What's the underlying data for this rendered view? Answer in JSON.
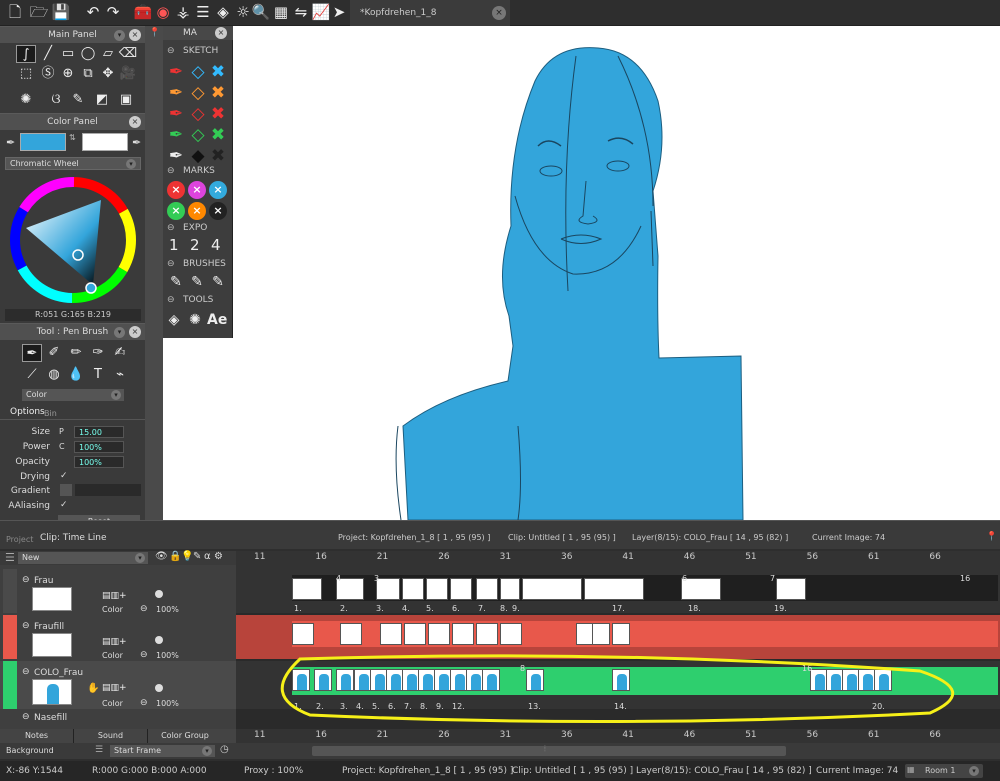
{
  "doc_tab": {
    "title": "*Kopfdrehen_1_8"
  },
  "main_panel": {
    "title": "Main Panel"
  },
  "color_panel": {
    "title": "Color Panel",
    "mode": "Chromatic Wheel",
    "readout": "R:051 G:165 B:219",
    "fg_color": "#33a5db",
    "bg_color": "#ffffff"
  },
  "tool_panel": {
    "title": "Tool : Pen Brush",
    "color_dropdown": "Color",
    "tabs": [
      "Options",
      "Bin"
    ],
    "size_label": "Size",
    "size_mode": "P",
    "size_value": "15.00",
    "power_label": "Power",
    "power_mode": "C",
    "power_value": "100%",
    "opacity_label": "Opacity",
    "opacity_value": "100%",
    "drying_label": "Drying",
    "gradient_label": "Gradient",
    "aaliasing_label": "AAliasing",
    "reset": "Reset"
  },
  "ma_panel": {
    "title": "MA",
    "sketch": "SKETCH",
    "marks": "MARKS",
    "expo": "EXPO",
    "brushes": "BRUSHES",
    "tools": "TOOLS",
    "expo_values": [
      "1",
      "2",
      "4"
    ],
    "ae": "Ae"
  },
  "timeline": {
    "tabs": [
      "Project",
      "Clip: Time Line"
    ],
    "project_info": "Project: Kopfdrehen_1_8 [ 1 , 95  (95) ]",
    "clip_info": "Clip: Untitled [ 1 , 95  (95) ]",
    "layer_info": "Layer(8/15): COLO_Frau [ 14 , 95  (82) ]",
    "current_image": "Current Image: 74",
    "new_label": "New",
    "ruler": [
      "11",
      "16",
      "21",
      "26",
      "31",
      "36",
      "41",
      "46",
      "51",
      "56",
      "61",
      "66"
    ],
    "layers": [
      {
        "name": "Frau",
        "color_label": "Color",
        "opacity": "100%"
      },
      {
        "name": "Fraufill",
        "color_label": "Color",
        "opacity": "100%"
      },
      {
        "name": "COLO_Frau",
        "color_label": "Color",
        "opacity": "100%"
      },
      {
        "name": "Nasefill"
      }
    ],
    "frau_numbers": [
      "1.",
      "2.",
      "3.",
      "4.",
      "5.",
      "6.",
      "7.",
      "8.",
      "9.",
      "17.",
      "18.",
      "19."
    ],
    "frau_box_labels": [
      "4",
      "3",
      "6",
      "7",
      "16"
    ],
    "colo_numbers": [
      "1.",
      "2.",
      "3.",
      "4.",
      "5.",
      "6.",
      "7.",
      "8.",
      "9.",
      "12.",
      "13.",
      "14.",
      "20."
    ],
    "colo_box_labels": [
      "8",
      "16"
    ],
    "bottom_tabs": [
      "Notes",
      "Sound",
      "Color Group"
    ],
    "background_label": "Background",
    "start_frame": "Start Frame",
    "frame_accent": "#2ecf6e",
    "fill_accent": "#e8584b"
  },
  "status": {
    "cursor": "X:-86  Y:1544",
    "rgba": "R:000 G:000 B:000 A:000",
    "proxy": "Proxy : 100%",
    "project": "Project: Kopfdrehen_1_8 [ 1 , 95  (95) ]",
    "clip": "Clip: Untitled [ 1 , 95  (95) ]",
    "layer": "Layer(8/15): COLO_Frau [ 14 , 95  (82) ]",
    "current": "Current Image: 74",
    "room": "Room 1"
  }
}
